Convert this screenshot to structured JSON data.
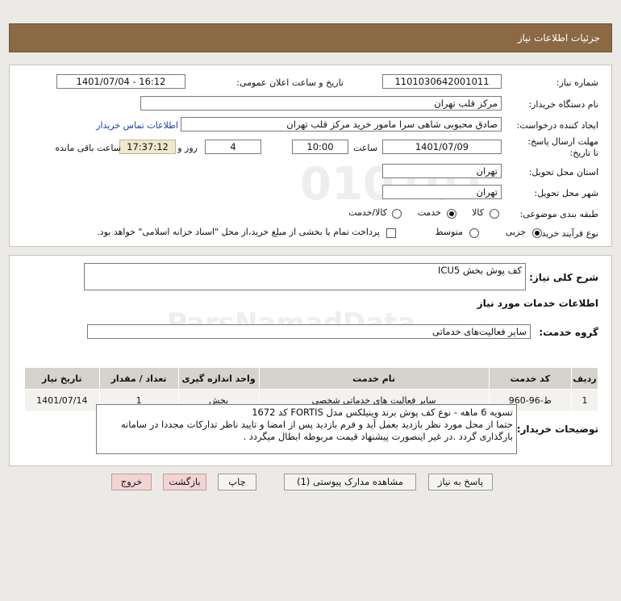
{
  "page": {
    "title": "جزئیات اطلاعات نیاز"
  },
  "form": {
    "need_number_label": "شماره نیاز:",
    "need_number": "1101030642001011",
    "announce_label": "تاریخ و ساعت اعلان عمومی:",
    "announce_value": "1401/07/04 - 16:12",
    "buyer_org_label": "نام دستگاه خریدار:",
    "buyer_org": "مرکز قلب تهران",
    "creator_label": "ایجاد کننده درخواست:",
    "creator": "صادق محبوبی شاهی سرا مامور خرید مرکز قلب تهران",
    "contact_link": "اطلاعات تماس خریدار",
    "deadline_label": "مهلت ارسال پاسخ: تا تاریخ:",
    "deadline_date": "1401/07/09",
    "time_label": "ساعت",
    "deadline_time": "10:00",
    "days_value": "4",
    "days_label": "روز و",
    "remaining_time": "17:37:12",
    "remaining_label": "ساعت باقی مانده",
    "province_label": "استان محل تحویل:",
    "province": "تهران",
    "city_label": "شهر محل تحویل:",
    "city": "تهران",
    "category_label": "طبقه بندی موضوعی:",
    "category_options": [
      "کالا",
      "خدمت",
      "کالا/خدمت"
    ],
    "category_selected": "خدمت",
    "process_label": "نوع فرآیند خرید :",
    "process_options": [
      "جزیی",
      "متوسط"
    ],
    "process_selected": "جزیی",
    "payment_note": "پرداخت تمام یا بخشی از مبلغ خرید،از محل \"اسناد خزانه اسلامی\" خواهد بود."
  },
  "details": {
    "summary_label": "شرح کلی نیاز:",
    "summary": "کف پوش بخش ICU5",
    "services_heading": "اطلاعات خدمات مورد نیاز",
    "service_group_label": "گروه خدمت:",
    "service_group": "سایر فعالیت‌های خدماتی",
    "table": {
      "headers": [
        "ردیف",
        "کد خدمت",
        "نام خدمت",
        "واحد اندازه گیری",
        "تعداد / مقدار",
        "تاریخ نیاز"
      ],
      "rows": [
        [
          "1",
          "ط-96-960",
          "سایر فعالیت های خدماتی شخصی",
          "بخش",
          "1",
          "1401/07/14"
        ]
      ]
    },
    "buyer_notes_label": "توضیحات خریدار:",
    "buyer_notes": [
      "تسویه 6 ماهه - نوع کف پوش برند وینیلکس مدل FORTIS  کد 1672",
      "حتما از محل مورد نظر بازدید بعمل آید و فرم بازدید پس از امضا و تایید ناظر تدارکات مجددا در سامانه",
      "بارگذاری گردد .در غیر اینصورت پیشنهاد قیمت مربوطه ابطال میگردد ."
    ]
  },
  "buttons": {
    "reply": "پاسخ به نیاز",
    "attachments": "مشاهده مدارک پیوستی (1)",
    "print": "چاپ",
    "back": "بازگشت",
    "exit": "خروج"
  },
  "colors": {
    "header": "#8b6a43",
    "link": "#1a3fa8",
    "table_header": "#d6d3cd"
  }
}
